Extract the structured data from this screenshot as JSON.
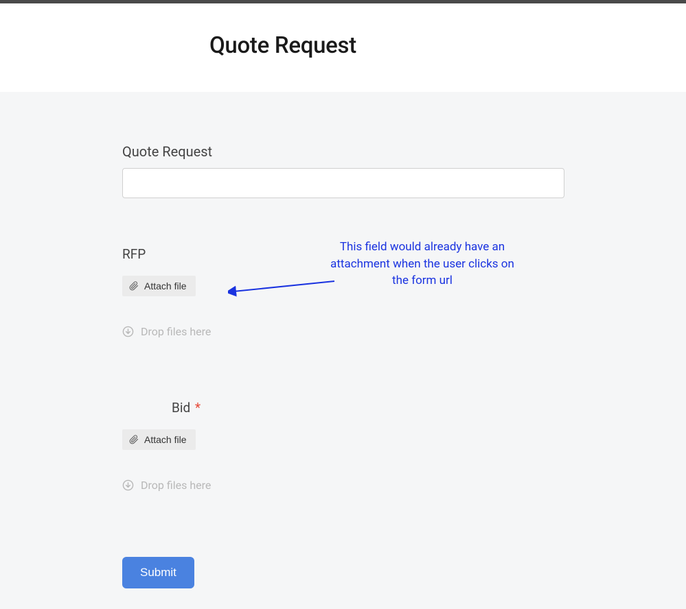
{
  "header": {
    "title": "Quote Request"
  },
  "form": {
    "field_quote": {
      "label": "Quote Request",
      "value": ""
    },
    "field_rfp": {
      "label": "RFP",
      "attach_label": "Attach file",
      "drop_label": "Drop files here"
    },
    "field_bid": {
      "label": "Bid",
      "required_mark": "*",
      "attach_label": "Attach file",
      "drop_label": "Drop files here"
    },
    "submit_label": "Submit"
  },
  "annotation": {
    "text": "This field would already have an attachment when the user clicks on the form url"
  }
}
